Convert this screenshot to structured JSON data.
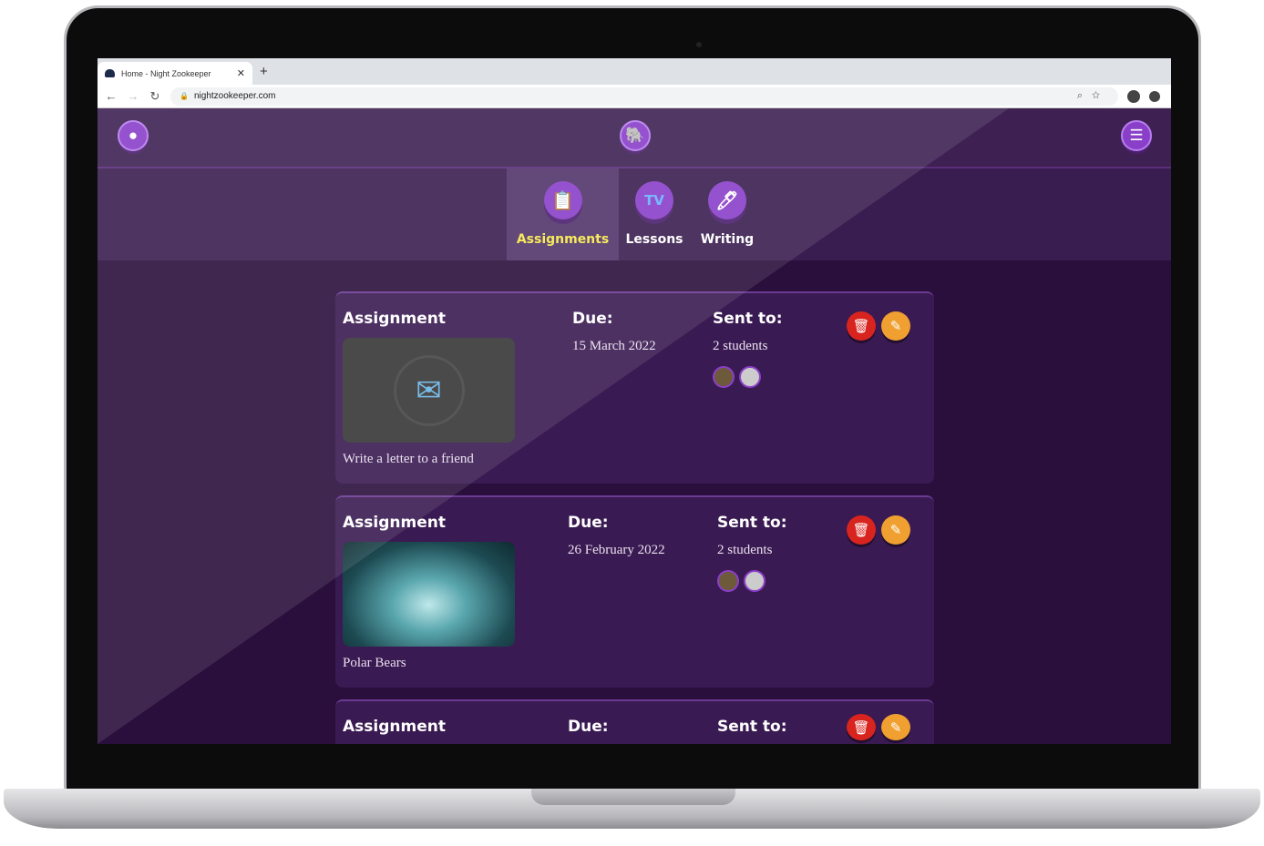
{
  "browser": {
    "tab_title": "Home - Night Zookeeper",
    "url": "nightzookeeper.com"
  },
  "header": {
    "profile_icon": "user-icon",
    "logo_icon": "elephant-icon",
    "menu_icon": "hamburger-icon"
  },
  "nav": {
    "tabs": [
      {
        "label": "Assignments",
        "active": true
      },
      {
        "label": "Lessons",
        "active": false
      },
      {
        "label": "Writing",
        "active": false
      }
    ]
  },
  "colors": {
    "active_tab_text": "#f5e84a",
    "background": "#2a0f3d"
  },
  "cards": [
    {
      "heading": "Assignment",
      "due_label": "Due:",
      "due": "15 March 2022",
      "sent_label": "Sent to:",
      "sent": "2 students",
      "title": "Write a letter to a friend"
    },
    {
      "heading": "Assignment",
      "due_label": "Due:",
      "due": "26 February 2022",
      "sent_label": "Sent to:",
      "sent": "2 students",
      "title": "Polar Bears"
    },
    {
      "heading": "Assignment",
      "due_label": "Due:",
      "sent_label": "Sent to:"
    }
  ]
}
